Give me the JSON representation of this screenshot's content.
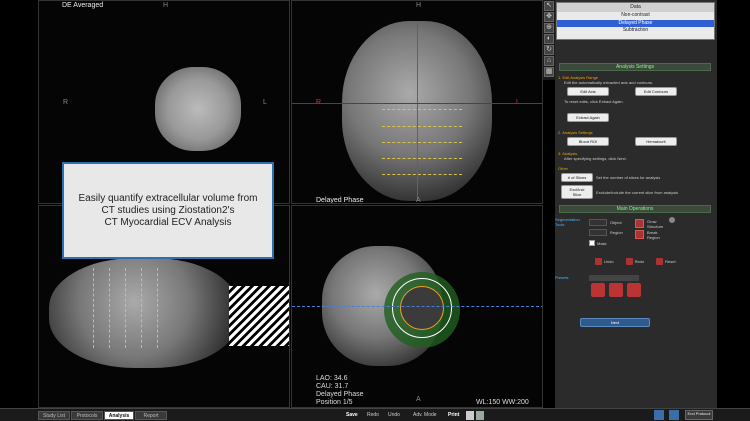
{
  "viewports": {
    "top_left_label": "DE Averaged",
    "top_left_orient": "H",
    "top_left_r": "R",
    "top_left_l": "L",
    "top_right_orient_top": "H",
    "top_right_r": "R",
    "top_right_l": "L",
    "top_right_bottom": "A",
    "top_right_phase": "Delayed Phase",
    "bottom_left_orient": "A",
    "bottom_right_lao": "LAO: 34.6",
    "bottom_right_cau": "CAU: 31.7",
    "bottom_right_phase": "Delayed Phase",
    "bottom_right_position": "Position 1/5",
    "bottom_right_wl": "WL:150 WW:200",
    "bottom_right_a": "A"
  },
  "overlay": {
    "line1": "Easily quantify extracellular volume from",
    "line2": "CT studies using Ziostation2's",
    "line3": "CT Myocardial ECV Analysis"
  },
  "data_panel": {
    "header": "Data",
    "rows": [
      "Non-contrast",
      "Delayed Phase",
      "Subtraction"
    ],
    "selected": "Delayed Phase"
  },
  "analysis": {
    "title": "Analysis Settings",
    "step1": "1. Edit Analysis Range",
    "step1_desc": "Edit the automatically extracted axis and contours.",
    "edit_axis": "Edit Axis",
    "edit_contours": "Edit Contours",
    "reset_desc": "To reset edits, click Extract Again.",
    "extract_again": "Extract Again",
    "step2": "2. Analysis Settings",
    "blood_roi": "Blood ROI",
    "hematocrit": "Hematocrit",
    "step3": "3. Analysis",
    "step3_desc": "After specifying settings, click Next.",
    "other": "Other",
    "num_slices": "# of Slices",
    "num_slices_desc": "Set the number of slices for analysis",
    "excl_slice": "Excl/Incl Slice",
    "excl_desc": "Exclude/include the current slice from analysis",
    "main_ops": "Main Operations",
    "seg_tools": "Segmentation Tools",
    "object": "Object",
    "region": "Region",
    "grow_structure": "Grow Structure",
    "break_region": "Break Region",
    "mask": "Mask",
    "undo": "Undo",
    "redo": "Redo",
    "reset": "Reset",
    "presets": "Presets",
    "next": "Next"
  },
  "bottom_tabs": [
    "Study List",
    "Protocols",
    "Analysis",
    "Report"
  ],
  "active_tab": "Analysis",
  "toolbar": {
    "save": "Save",
    "redo": "Redo",
    "undo": "Undo",
    "adv_mode": "Adv. Mode",
    "print": "Print",
    "end_protocol": "End Protocol"
  }
}
